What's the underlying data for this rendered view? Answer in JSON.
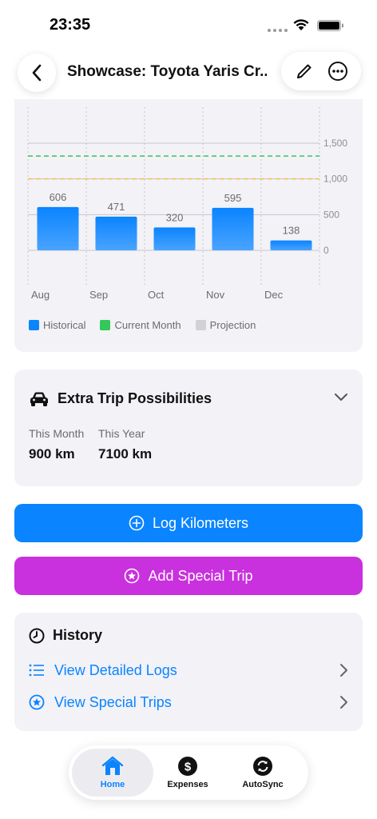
{
  "status": {
    "time": "23:35"
  },
  "header": {
    "title": "Showcase: Toyota Yaris Cr..."
  },
  "chart_data": {
    "type": "bar",
    "categories": [
      "Aug",
      "Sep",
      "Oct",
      "Nov",
      "Dec"
    ],
    "series": [
      {
        "name": "Historical",
        "values": [
          606,
          471,
          320,
          595,
          138
        ]
      }
    ],
    "y_ticks": [
      "1,500",
      "1,000",
      "500",
      "0"
    ],
    "ylim": [
      0,
      1500
    ],
    "reference_lines": [
      {
        "label": "green-dashed",
        "value": 1320,
        "color": "#34c759"
      },
      {
        "label": "orange-dashed",
        "value": 1000,
        "color": "#f5c242"
      }
    ],
    "legend": [
      {
        "label": "Historical",
        "color": "#0a84ff"
      },
      {
        "label": "Current Month",
        "color": "#34c759"
      },
      {
        "label": "Projection",
        "color": "#d1d1d6"
      }
    ],
    "legend_position": "bottom-left",
    "grid": true
  },
  "extra": {
    "title": "Extra Trip Possibilities",
    "month_label": "This Month",
    "month_value": "900 km",
    "year_label": "This Year",
    "year_value": "7100 km"
  },
  "actions": {
    "log_label": "Log Kilometers",
    "special_label": "Add Special Trip"
  },
  "history": {
    "title": "History",
    "logs_label": "View Detailed Logs",
    "special_label": "View Special Trips"
  },
  "tabs": {
    "home": "Home",
    "expenses": "Expenses",
    "autosync": "AutoSync",
    "selected": "Home"
  },
  "colors": {
    "accent": "#0a84ff",
    "special": "#c930de"
  }
}
